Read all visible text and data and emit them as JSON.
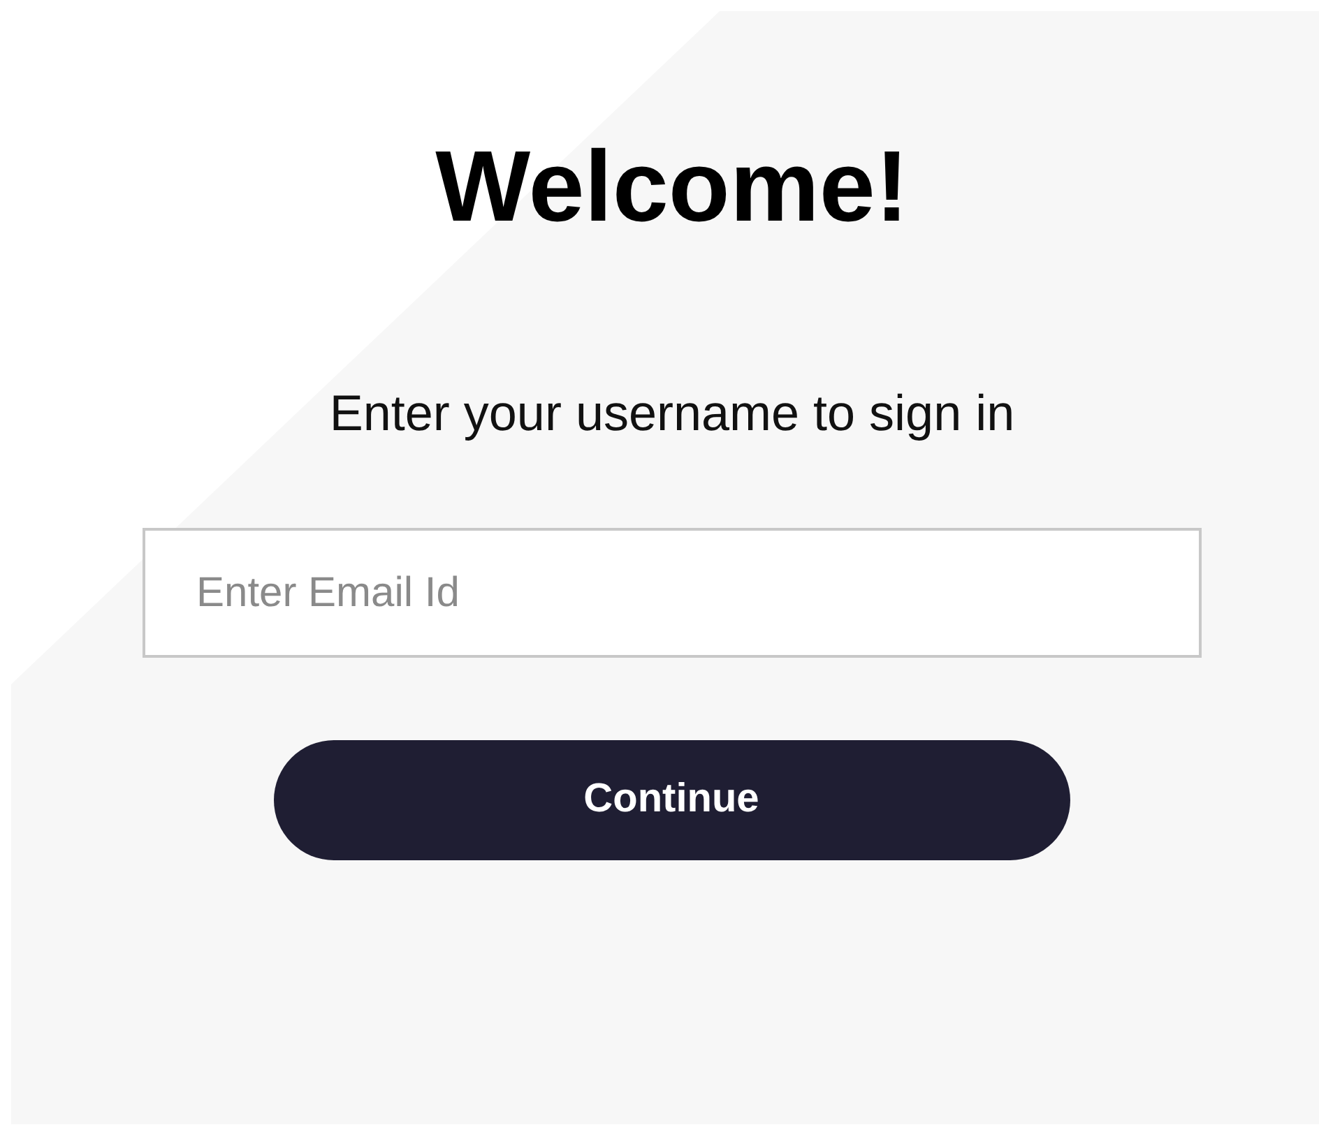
{
  "heading": "Welcome!",
  "subtitle": "Enter your username to sign in",
  "email_field": {
    "placeholder": "Enter Email Id"
  },
  "button": "Continue"
}
